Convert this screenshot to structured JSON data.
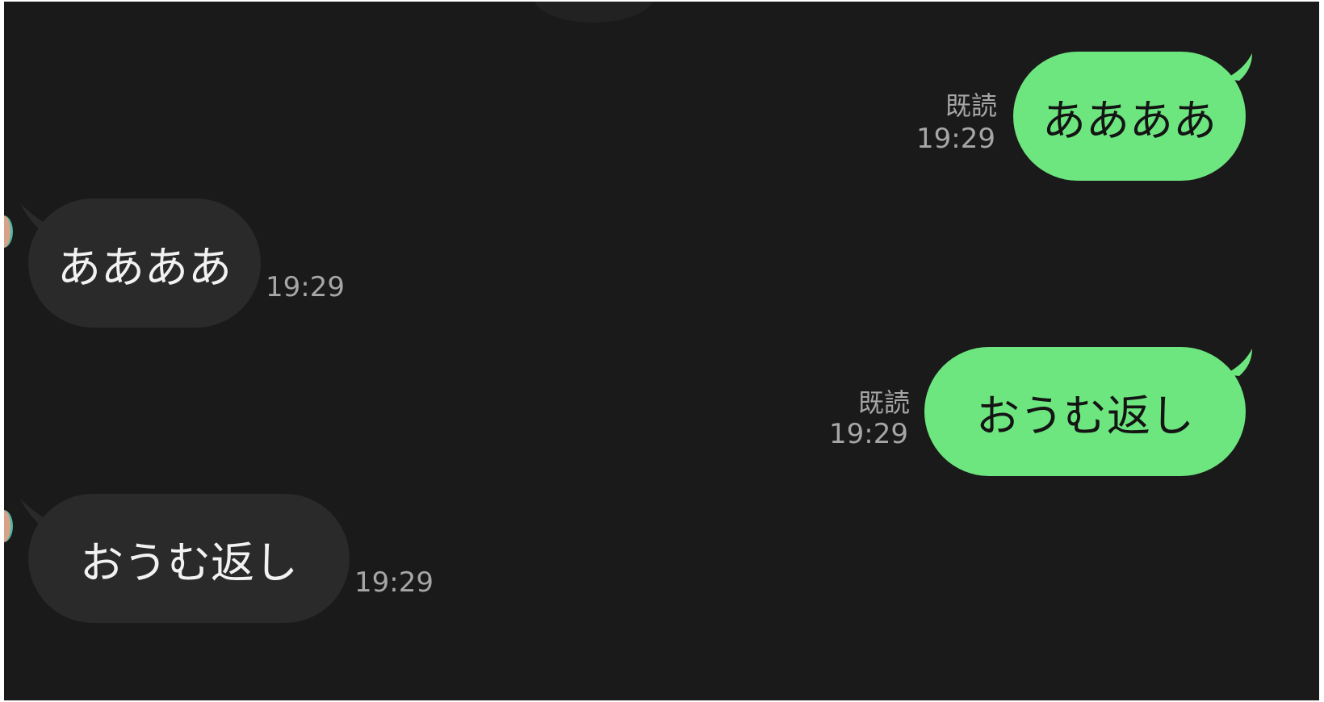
{
  "messages": [
    {
      "direction": "sent",
      "text": "ああああ",
      "read": "既読",
      "time": "19:29"
    },
    {
      "direction": "received",
      "text": "ああああ",
      "time": "19:29"
    },
    {
      "direction": "sent",
      "text": "おうむ返し",
      "read": "既読",
      "time": "19:29"
    },
    {
      "direction": "received",
      "text": "おうむ返し",
      "time": "19:29"
    }
  ],
  "colors": {
    "background": "#1a1a1a",
    "sent_bubble": "#6de67f",
    "received_bubble": "#2a2a2a",
    "meta_text": "#a6a6a6"
  },
  "icons": [
    "avatar"
  ]
}
